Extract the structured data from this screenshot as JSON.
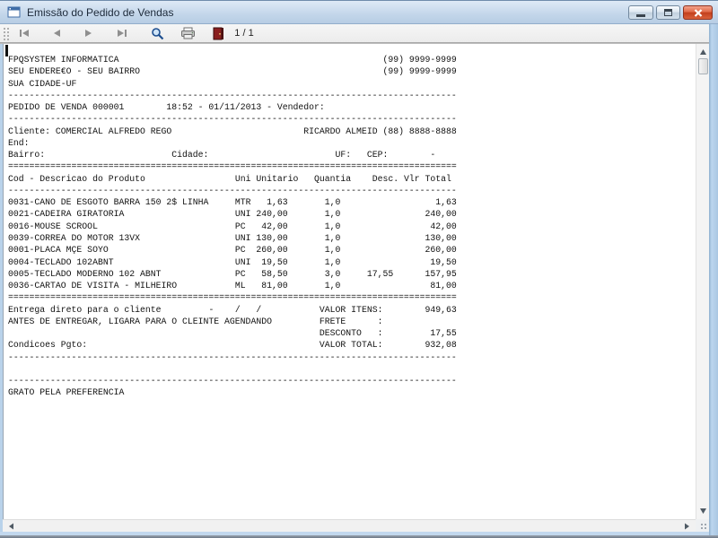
{
  "window": {
    "title": "Emissão do Pedido de Vendas",
    "icon": "form-icon",
    "controls": [
      {
        "name": "minimize-button",
        "icon": "minimize-icon"
      },
      {
        "name": "maximize-button",
        "icon": "maximize-icon"
      },
      {
        "name": "close-button",
        "icon": "close-icon"
      }
    ]
  },
  "toolbar": {
    "page_indicator": "1 / 1",
    "buttons": [
      {
        "name": "first-page-button",
        "icon": "first-page-icon",
        "enabled": false
      },
      {
        "name": "previous-page-button",
        "icon": "previous-page-icon",
        "enabled": false
      },
      {
        "name": "next-page-button",
        "icon": "next-page-icon",
        "enabled": false
      },
      {
        "name": "last-page-button",
        "icon": "last-page-icon",
        "enabled": false
      },
      {
        "name": "zoom-button",
        "icon": "magnifier-icon",
        "enabled": true
      },
      {
        "name": "print-button",
        "icon": "printer-icon",
        "enabled": true
      },
      {
        "name": "exit-button",
        "icon": "door-icon",
        "enabled": true
      }
    ]
  },
  "colors": {
    "titlebar_blue": "#c3d6ea",
    "window_border_blue": "#a9c6e2",
    "close_red": "#c23f1d",
    "door_red": "#8a1f1f",
    "magnifier_blue": "#1d4e8f",
    "report_text": "#111111"
  },
  "report": {
    "company": {
      "name": "FPQSYSTEM INFORMATICA",
      "phone1": "(99) 9999-9999",
      "address": "SEU ENDERE€O - SEU BAIRRO",
      "phone2": "(99) 9999-9999",
      "city": "SUA CIDADE-UF"
    },
    "order": {
      "header": "PEDIDO DE VENDA 000001",
      "time": "18:52",
      "date": "01/11/2013",
      "vendedor_label": "Vendedor:"
    },
    "client": {
      "cliente_label": "Cliente:",
      "cliente": "COMERCIAL ALFREDO REGO",
      "contact": "RICARDO ALMEID (88) 8888-8888",
      "end_label": "End:",
      "bairro_label": "Bairro:",
      "cidade_label": "Cidade:",
      "uf_label": "UF:",
      "cep_label": "CEP:",
      "cep_value": "-"
    },
    "items_columns": [
      "Cod - Descricao do Produto",
      "Uni",
      "Unitario",
      "Quantia",
      "Desc.",
      "Vlr Total"
    ],
    "items": [
      {
        "cod_desc": "0031-CANO DE ESGOTO BARRA 150 2$ LINHA",
        "uni": "MTR",
        "unitario": "1,63",
        "quantia": "1,0",
        "desc": "",
        "vlr_total": "1,63"
      },
      {
        "cod_desc": "0021-CADEIRA GIRATORIA",
        "uni": "UNI",
        "unitario": "240,00",
        "quantia": "1,0",
        "desc": "",
        "vlr_total": "240,00"
      },
      {
        "cod_desc": "0016-MOUSE SCROOL",
        "uni": "PC",
        "unitario": "42,00",
        "quantia": "1,0",
        "desc": "",
        "vlr_total": "42,00"
      },
      {
        "cod_desc": "0039-CORREA DO MOTOR 13VX",
        "uni": "UNI",
        "unitario": "130,00",
        "quantia": "1,0",
        "desc": "",
        "vlr_total": "130,00"
      },
      {
        "cod_desc": "0001-PLACA MÇE SOYO",
        "uni": "PC",
        "unitario": "260,00",
        "quantia": "1,0",
        "desc": "",
        "vlr_total": "260,00"
      },
      {
        "cod_desc": "0004-TECLADO 102ABNT",
        "uni": "UNI",
        "unitario": "19,50",
        "quantia": "1,0",
        "desc": "",
        "vlr_total": "19,50"
      },
      {
        "cod_desc": "0005-TECLADO MODERNO 102 ABNT",
        "uni": "PC",
        "unitario": "58,50",
        "quantia": "3,0",
        "desc": "17,55",
        "vlr_total": "157,95"
      },
      {
        "cod_desc": "0036-CARTAO DE VISITA - MILHEIRO",
        "uni": "ML",
        "unitario": "81,00",
        "quantia": "1,0",
        "desc": "",
        "vlr_total": "81,00"
      }
    ],
    "notes": [
      "Entrega direto para o cliente  -   /  /",
      "ANTES DE ENTREGAR, LIGARA PARA O CLEINTE AGENDANDO",
      "Condicoes Pgto:"
    ],
    "totals": {
      "valor_itens_label": "VALOR ITENS:",
      "valor_itens": "949,63",
      "frete_label": "FRETE",
      "frete": "",
      "desconto_label": "DESCONTO",
      "desconto": "17,55",
      "valor_total_label": "VALOR TOTAL:",
      "valor_total": "932,08"
    },
    "footer": "GRATO PELA PREFERENCIA",
    "lines": [
      [
        {
          "c": 0,
          "t": "FPQSYSTEM INFORMATICA"
        },
        {
          "c": 71,
          "t": "(99) 9999-9999"
        }
      ],
      [
        {
          "c": 0,
          "t": "SEU ENDERE€O - SEU BAIRRO"
        },
        {
          "c": 71,
          "t": "(99) 9999-9999"
        }
      ],
      [
        {
          "c": 0,
          "t": "SUA CIDADE-UF"
        }
      ],
      [
        {
          "c": 0,
          "r": "-",
          "n": 85
        }
      ],
      [
        {
          "c": 0,
          "t": "PEDIDO DE VENDA 000001"
        },
        {
          "c": 30,
          "t": "18:52 - 01/11/2013 - Vendedor:"
        }
      ],
      [
        {
          "c": 0,
          "r": "-",
          "n": 85
        }
      ],
      [
        {
          "c": 0,
          "t": "Cliente: COMERCIAL ALFREDO REGO"
        },
        {
          "c": 56,
          "t": "RICARDO ALMEID (88) 8888-8888"
        }
      ],
      [
        {
          "c": 0,
          "t": "End:"
        }
      ],
      [
        {
          "c": 0,
          "t": "Bairro:"
        },
        {
          "c": 31,
          "t": "Cidade:"
        },
        {
          "c": 62,
          "t": "UF:"
        },
        {
          "c": 68,
          "t": "CEP:"
        },
        {
          "c": 80,
          "t": "-"
        }
      ],
      [
        {
          "c": 0,
          "r": "=",
          "n": 85
        }
      ],
      [
        {
          "c": 0,
          "t": "Cod - Descricao do Produto"
        },
        {
          "c": 43,
          "t": "Uni Unitario"
        },
        {
          "c": 58,
          "t": "Quantia"
        },
        {
          "c": 69,
          "t": "Desc. Vlr Total"
        }
      ],
      [
        {
          "c": 0,
          "r": "-",
          "n": 85
        }
      ],
      [
        {
          "c": 0,
          "t": "0031-CANO DE ESGOTO BARRA 150 2$ LINHA"
        },
        {
          "c": 43,
          "t": "MTR"
        },
        {
          "c": 49,
          "t": "1,63"
        },
        {
          "c": 60,
          "t": "1,0"
        },
        {
          "c": 81,
          "t": "1,63"
        }
      ],
      [
        {
          "c": 0,
          "t": "0021-CADEIRA GIRATORIA"
        },
        {
          "c": 43,
          "t": "UNI"
        },
        {
          "c": 47,
          "t": "240,00"
        },
        {
          "c": 60,
          "t": "1,0"
        },
        {
          "c": 79,
          "t": "240,00"
        }
      ],
      [
        {
          "c": 0,
          "t": "0016-MOUSE SCROOL"
        },
        {
          "c": 43,
          "t": "PC"
        },
        {
          "c": 48,
          "t": "42,00"
        },
        {
          "c": 60,
          "t": "1,0"
        },
        {
          "c": 80,
          "t": "42,00"
        }
      ],
      [
        {
          "c": 0,
          "t": "0039-CORREA DO MOTOR 13VX"
        },
        {
          "c": 43,
          "t": "UNI"
        },
        {
          "c": 47,
          "t": "130,00"
        },
        {
          "c": 60,
          "t": "1,0"
        },
        {
          "c": 79,
          "t": "130,00"
        }
      ],
      [
        {
          "c": 0,
          "t": "0001-PLACA MÇE SOYO"
        },
        {
          "c": 43,
          "t": "PC"
        },
        {
          "c": 47,
          "t": "260,00"
        },
        {
          "c": 60,
          "t": "1,0"
        },
        {
          "c": 79,
          "t": "260,00"
        }
      ],
      [
        {
          "c": 0,
          "t": "0004-TECLADO 102ABNT"
        },
        {
          "c": 43,
          "t": "UNI"
        },
        {
          "c": 48,
          "t": "19,50"
        },
        {
          "c": 60,
          "t": "1,0"
        },
        {
          "c": 80,
          "t": "19,50"
        }
      ],
      [
        {
          "c": 0,
          "t": "0005-TECLADO MODERNO 102 ABNT"
        },
        {
          "c": 43,
          "t": "PC"
        },
        {
          "c": 48,
          "t": "58,50"
        },
        {
          "c": 60,
          "t": "3,0"
        },
        {
          "c": 68,
          "t": "17,55"
        },
        {
          "c": 79,
          "t": "157,95"
        }
      ],
      [
        {
          "c": 0,
          "t": "0036-CARTAO DE VISITA - MILHEIRO"
        },
        {
          "c": 43,
          "t": "ML"
        },
        {
          "c": 48,
          "t": "81,00"
        },
        {
          "c": 60,
          "t": "1,0"
        },
        {
          "c": 80,
          "t": "81,00"
        }
      ],
      [
        {
          "c": 0,
          "r": "=",
          "n": 85
        }
      ],
      [
        {
          "c": 0,
          "t": "Entrega direto para o cliente"
        },
        {
          "c": 38,
          "t": "-"
        },
        {
          "c": 43,
          "t": "/"
        },
        {
          "c": 47,
          "t": "/"
        },
        {
          "c": 59,
          "t": "VALOR ITENS:"
        },
        {
          "c": 79,
          "t": "949,63"
        }
      ],
      [
        {
          "c": 0,
          "t": "ANTES DE ENTREGAR, LIGARA PARA O CLEINTE AGENDANDO"
        },
        {
          "c": 59,
          "t": "FRETE"
        },
        {
          "c": 70,
          "t": ":"
        }
      ],
      [
        {
          "c": 59,
          "t": "DESCONTO"
        },
        {
          "c": 70,
          "t": ":"
        },
        {
          "c": 80,
          "t": "17,55"
        }
      ],
      [
        {
          "c": 0,
          "t": "Condicoes Pgto:"
        },
        {
          "c": 59,
          "t": "VALOR TOTAL:"
        },
        {
          "c": 79,
          "t": "932,08"
        }
      ],
      [
        {
          "c": 0,
          "r": "-",
          "n": 85
        }
      ],
      [],
      [
        {
          "c": 0,
          "r": "-",
          "n": 85
        }
      ],
      [
        {
          "c": 0,
          "t": "GRATO PELA PREFERENCIA"
        }
      ]
    ]
  }
}
